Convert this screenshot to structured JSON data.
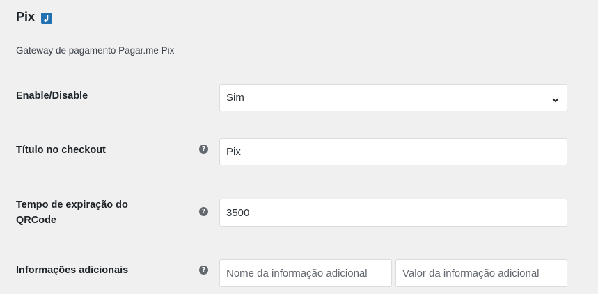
{
  "header": {
    "title": "Pix",
    "return_icon": "return-arrow-icon"
  },
  "subtitle": "Gateway de pagamento Pagar.me Pix",
  "form": {
    "enable_disable": {
      "label": "Enable/Disable",
      "value": "Sim"
    },
    "checkout_title": {
      "label": "Título no checkout",
      "value": "Pix",
      "help_icon": "help-icon"
    },
    "qrcode_expiration": {
      "label_line1": "Tempo de expiração do",
      "label_line2": "QRCode",
      "value": "3500",
      "help_icon": "help-icon"
    },
    "additional_info": {
      "label": "Informações adicionais",
      "name_placeholder": "Nome da informação adicional",
      "value_placeholder": "Valor da informação adicional",
      "help_icon": "help-icon"
    }
  },
  "colors": {
    "background": "#f0f0f1",
    "accent": "#2271b1",
    "help_icon": "#646970"
  }
}
